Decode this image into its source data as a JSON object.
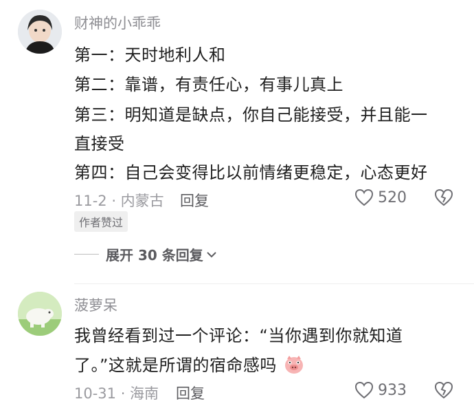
{
  "comments": [
    {
      "username": "财神的小乖乖",
      "lines": [
        "第一：天时地利人和",
        "第二：靠谱，有责任心，有事儿真上",
        "第三：明知道是缺点，你自己能接受，并且能一",
        "直接受",
        "第四：自己会变得比以前情绪更稳定，心态更好"
      ],
      "date_location": "11-2 · 内蒙古",
      "reply_label": "回复",
      "likes": "520",
      "badge": "作者赞过",
      "expand_label": "展开 30 条回复"
    },
    {
      "username": "菠萝呆",
      "lines": [
        "我曾经看到过一个评论：“当你遇到你就知道",
        "了。”这就是所谓的宿命感吗"
      ],
      "date_location": "10-31 · 海南",
      "reply_label": "回复",
      "likes": "933"
    }
  ],
  "colors": {
    "username": "#8e8e93",
    "text": "#1f1f1f",
    "meta": "#9a9a9f"
  },
  "icons": {
    "like": "heart-outline-icon",
    "dislike": "broken-heart-icon",
    "expand": "chevron-down-icon",
    "emoji": "pig-face-icon"
  }
}
